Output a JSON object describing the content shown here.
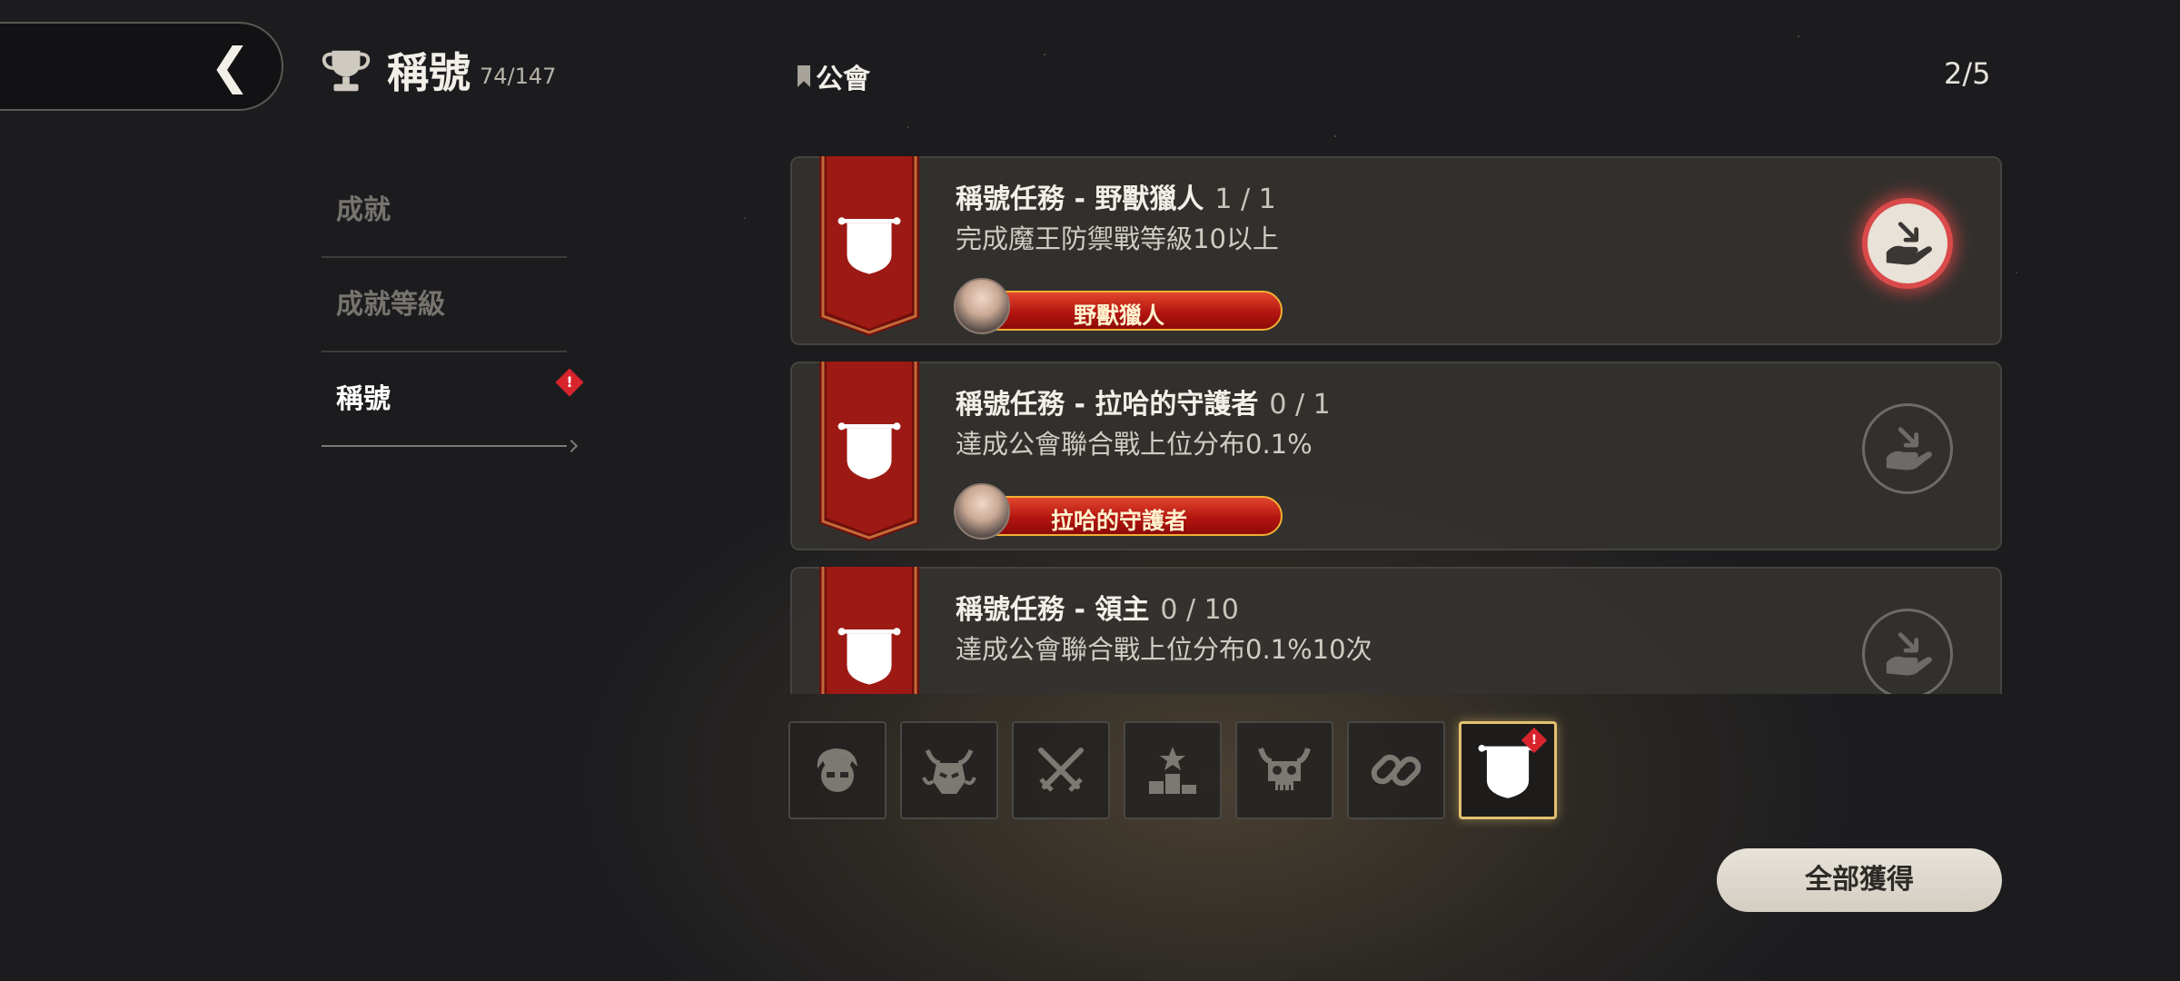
{
  "header": {
    "back_icon": "chevron-left-icon",
    "trophy_icon": "trophy-icon",
    "title": "稱號",
    "count": "74/147"
  },
  "sidebar": {
    "items": [
      {
        "label": "成就",
        "active": false
      },
      {
        "label": "成就等級",
        "active": false
      },
      {
        "label": "稱號",
        "active": true,
        "badge": "!"
      }
    ]
  },
  "section": {
    "icon": "bookmark-icon",
    "label": "公會",
    "page_indicator": "2/5"
  },
  "quests": [
    {
      "title": "稱號任務 - 野獸獵人",
      "progress": "1 / 1",
      "description": "完成魔王防禦戰等級10以上",
      "title_name": "野獸獵人",
      "claimable": true
    },
    {
      "title": "稱號任務 - 拉哈的守護者",
      "progress": "0 / 1",
      "description": "達成公會聯合戰上位分布0.1%",
      "title_name": "拉哈的守護者",
      "claimable": false
    },
    {
      "title": "稱號任務 - 領主",
      "progress": "0 / 10",
      "description": "達成公會聯合戰上位分布0.1%10次",
      "claimable": false
    }
  ],
  "category_tabs": [
    {
      "icon": "hero-face-icon",
      "active": false
    },
    {
      "icon": "demon-head-icon",
      "active": false
    },
    {
      "icon": "crossed-swords-icon",
      "active": false
    },
    {
      "icon": "podium-star-icon",
      "active": false
    },
    {
      "icon": "horned-skull-icon",
      "active": false
    },
    {
      "icon": "chain-link-icon",
      "active": false
    },
    {
      "icon": "banner-shield-icon",
      "active": true,
      "badge": "!"
    }
  ],
  "claim_all_label": "全部獲得",
  "colors": {
    "accent_red": "#d94a4a",
    "banner_red": "#8a1410",
    "active_tab_gold": "#e3c16e",
    "badge_red": "#d8242c"
  }
}
